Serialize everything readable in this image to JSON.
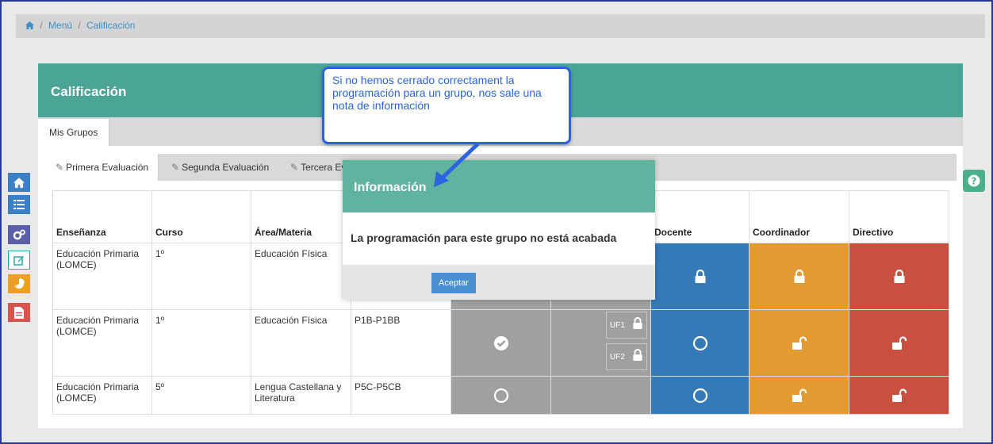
{
  "breadcrumb": {
    "home_icon": "home-icon",
    "menu": "Menú",
    "current": "Calificación"
  },
  "panel": {
    "title": "Calificación",
    "tab": "Mis Grupos"
  },
  "eval_tabs": [
    "Primera Evaluación",
    "Segunda Evaluación",
    "Tercera Evaluación"
  ],
  "table": {
    "headers": [
      "Enseñanza",
      "Curso",
      "Área/Materia",
      "",
      "",
      "",
      "Docente",
      "Coordinador",
      "Directivo"
    ],
    "rows": [
      {
        "ensenanza": "Educación Primaria (LOMCE)",
        "curso": "1º",
        "materia": "Educación Física",
        "grupo": ""
      },
      {
        "ensenanza": "Educación Primaria (LOMCE)",
        "curso": "1º",
        "materia": "Educación Física",
        "grupo": "P1B-P1BB",
        "uf1": "UF1",
        "uf2": "UF2"
      },
      {
        "ensenanza": "Educación Primaria (LOMCE)",
        "curso": "5º",
        "materia": "Lengua Castellana y Literatura",
        "grupo": "P5C-P5CB"
      }
    ]
  },
  "modal": {
    "title": "Información",
    "message": "La programación para este grupo no está acabada",
    "button": "Aceptar"
  },
  "callout": {
    "text": "Si no hemos cerrado correctament la programación para un grupo, nos sale una nota de información"
  },
  "colors": {
    "teal": "#4aa597",
    "blue": "#337ab7",
    "orange": "#e39a30",
    "red": "#c8503e",
    "gray": "#a0a0a0",
    "callout": "#2b63e0"
  },
  "sidebar_icons": [
    "home-icon",
    "list-icon",
    "cogs-icon",
    "edit-icon",
    "pie-chart-icon",
    "document-icon"
  ]
}
